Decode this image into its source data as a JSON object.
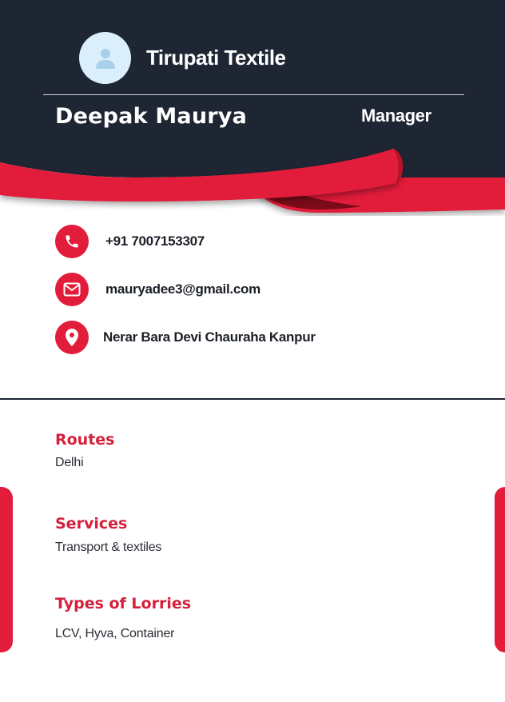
{
  "header": {
    "company": "Tirupati Textile",
    "name": "Deepak Maurya",
    "title": "Manager",
    "avatar_icon": "user-icon"
  },
  "contacts": [
    {
      "icon": "phone-icon",
      "text": "+91 7007153307"
    },
    {
      "icon": "mail-icon",
      "text": "mauryadee3@gmail.com"
    },
    {
      "icon": "location-pin-icon",
      "text": "Nerar Bara Devi Chauraha Kanpur"
    }
  ],
  "sections": [
    {
      "heading": "Routes",
      "value": "Delhi"
    },
    {
      "heading": "Services",
      "value": "Transport & textiles"
    },
    {
      "heading": "Types of Lorries",
      "value": "LCV, Hyva, Container"
    }
  ],
  "colors": {
    "navy": "#1e2533",
    "accent_red": "#e21d3b",
    "dark_red": "#8e0d1d",
    "avatar_bg": "#dbeefb"
  }
}
